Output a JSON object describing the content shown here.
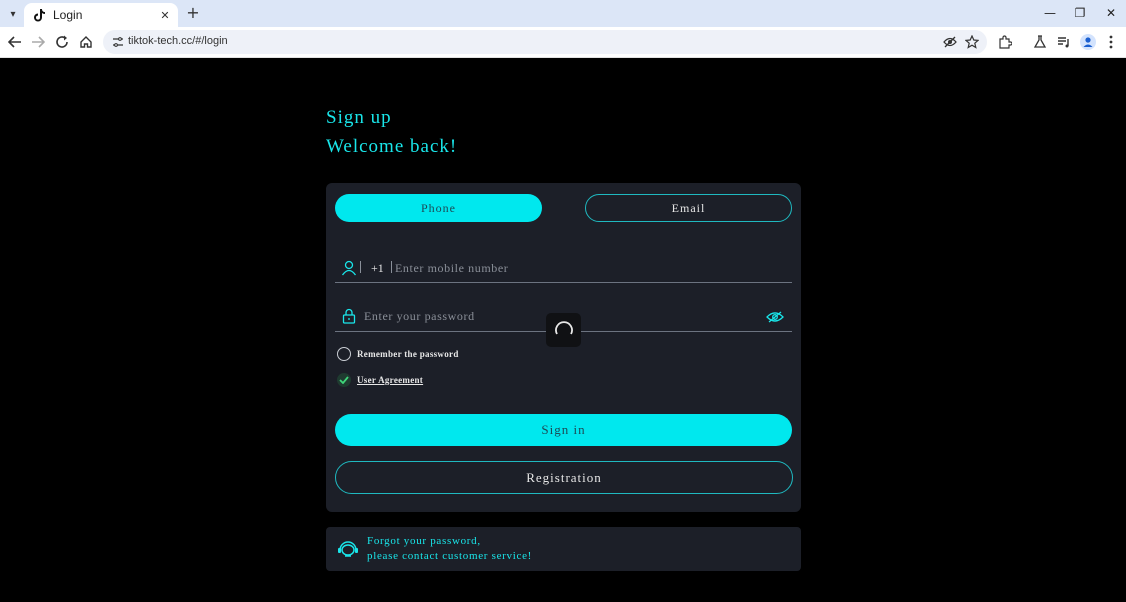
{
  "browser": {
    "tab_title": "Login",
    "url": "tiktok-tech.cc/#/login",
    "close_tab_glyph": "✕",
    "new_tab_glyph": "+",
    "minimize_glyph": "—",
    "restore_glyph": "❐",
    "close_window_glyph": "✕"
  },
  "page": {
    "heading_signup": "Sign up",
    "heading_welcome": "Welcome back!",
    "tabs": {
      "phone": "Phone",
      "email": "Email"
    },
    "country_code": "+1",
    "phone_placeholder": "Enter mobile number",
    "password_placeholder": "Enter your password",
    "remember_label": "Remember the password",
    "agreement_label": "User Agreement",
    "signin_label": "Sign in",
    "registration_label": "Registration",
    "help_line1": "Forgot your password,",
    "help_line2": "please contact customer service!"
  },
  "colors": {
    "accent": "#00e8ee",
    "card_bg": "#1c1f28",
    "page_bg": "#000000"
  }
}
